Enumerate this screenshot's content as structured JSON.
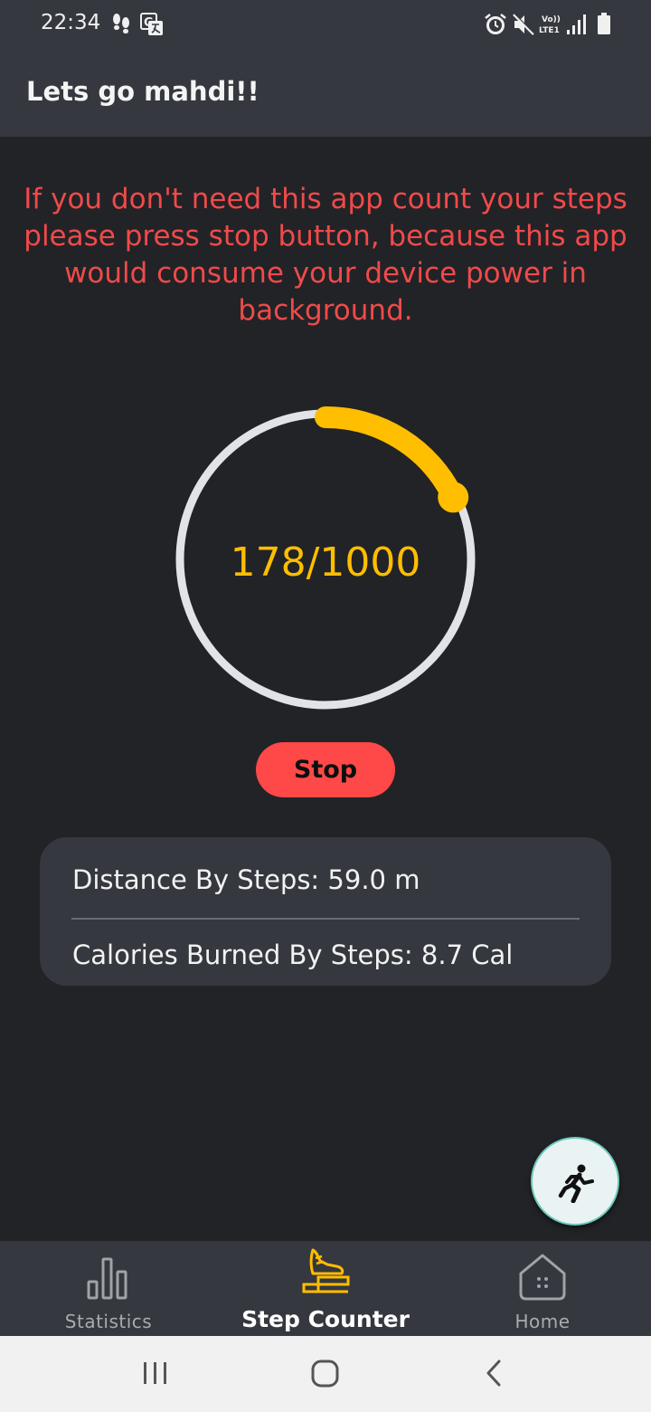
{
  "status_bar": {
    "time": "22:34",
    "left_icons": [
      "footsteps-icon",
      "translate-icon"
    ],
    "right_icons": [
      "alarm-icon",
      "mute-icon",
      "volte-icon",
      "signal-icon",
      "battery-icon"
    ],
    "volte_label": "Vo)) LTE1"
  },
  "app_bar": {
    "title": "Lets go mahdi!!"
  },
  "warning": {
    "text": "If you don't need this app count your steps please press stop button, because this app would consume your device power in background.",
    "color": "#f04a4a"
  },
  "progress": {
    "current": 178,
    "goal": 1000,
    "display": "178/1000",
    "track_color": "#e1e3e6",
    "fill_color": "#ffbe00"
  },
  "stop_button": {
    "label": "Stop",
    "color": "#ff4848"
  },
  "stats": {
    "distance": "Distance By Steps: 59.0 m",
    "calories": "Calories Burned By Steps: 8.7 Cal"
  },
  "fab": {
    "icon": "running-person-icon"
  },
  "bottom_nav": {
    "items": [
      {
        "label": "Statistics",
        "icon": "bar-chart-icon",
        "active": false
      },
      {
        "label": "Step Counter",
        "icon": "shoe-step-icon",
        "active": true
      },
      {
        "label": "Home",
        "icon": "home-icon",
        "active": false
      }
    ]
  },
  "system_nav": {
    "buttons": [
      "recents-icon",
      "home-circle-icon",
      "back-icon"
    ]
  }
}
